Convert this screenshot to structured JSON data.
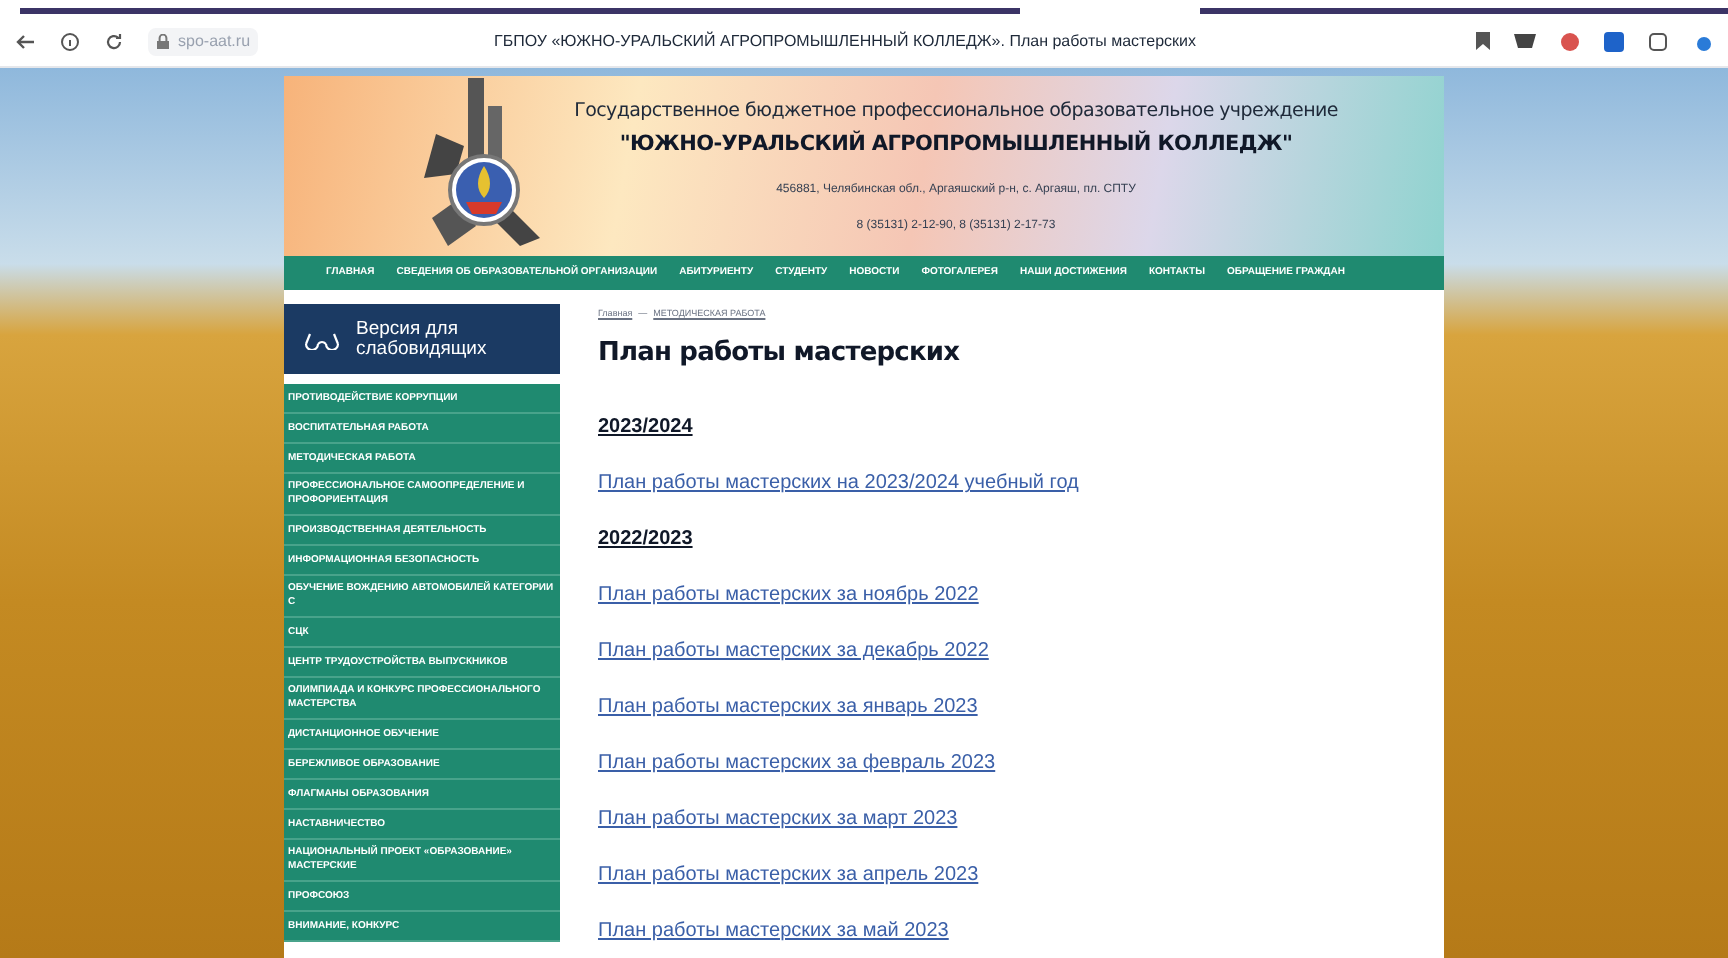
{
  "browser": {
    "url": "spo-aat.ru",
    "tab_title": "ГБПОУ «ЮЖНО-УРАЛЬСКИЙ АГРОПРОМЫШЛЕННЫЙ КОЛЛЕДЖ». План работы мастерских"
  },
  "header": {
    "org_type": "Государственное бюджетное профессиональное образовательное учреждение",
    "org_name": "\"ЮЖНО-УРАЛЬСКИЙ АГРОПРОМЫШЛЕННЫЙ КОЛЛЕДЖ\"",
    "address": "456881, Челябинская обл., Аргаяшский р-н, с. Аргаяш, пл. СПТУ",
    "phones": "8 (35131) 2-12-90, 8 (35131) 2-17-73"
  },
  "nav": [
    "ГЛАВНАЯ",
    "СВЕДЕНИЯ ОБ ОБРАЗОВАТЕЛЬНОЙ ОРГАНИЗАЦИИ",
    "АБИТУРИЕНТУ",
    "СТУДЕНТУ",
    "НОВОСТИ",
    "ФОТОГАЛЕРЕЯ",
    "НАШИ ДОСТИЖЕНИЯ",
    "КОНТАКТЫ",
    "ОБРАЩЕНИЕ ГРАЖДАН"
  ],
  "accessibility_button": "Версия для слабовидящих",
  "sidebar": {
    "items": [
      "ПРОТИВОДЕЙСТВИЕ КОРРУПЦИИ",
      "ВОСПИТАТЕЛЬНАЯ РАБОТА",
      "МЕТОДИЧЕСКАЯ РАБОТА",
      "ПРОФЕССИОНАЛЬНОЕ САМООПРЕДЕЛЕНИЕ И ПРОФОРИЕНТАЦИЯ",
      "ПРОИЗВОДСТВЕННАЯ ДЕЯТЕЛЬНОСТЬ",
      "ИНФОРМАЦИОННАЯ БЕЗОПАСНОСТЬ",
      "ОБУЧЕНИЕ ВОЖДЕНИЮ АВТОМОБИЛЕЙ КАТЕГОРИИ С",
      "СЦК",
      "ЦЕНТР ТРУДОУСТРОЙСТВА ВЫПУСКНИКОВ",
      "ОЛИМПИАДА И КОНКУРС ПРОФЕССИОНАЛЬНОГО МАСТЕРСТВА",
      "ДИСТАНЦИОННОЕ ОБУЧЕНИЕ",
      "БЕРЕЖЛИВОЕ ОБРАЗОВАНИЕ",
      "ФЛАГМАНЫ ОБРАЗОВАНИЯ",
      "НАСТАВНИЧЕСТВО",
      "НАЦИОНАЛЬНЫЙ ПРОЕКТ «ОБРАЗОВАНИЕ» МАСТЕРСКИЕ",
      "ПРОФСОЮЗ",
      "ВНИМАНИЕ, КОНКУРС"
    ]
  },
  "breadcrumbs": [
    "Главная",
    "—",
    "МЕТОДИЧЕСКАЯ РАБОТА"
  ],
  "page_title": "План работы мастерских",
  "content": [
    {
      "kind": "heading",
      "text": "2023/2024"
    },
    {
      "kind": "link",
      "text": "План работы мастерских на 2023/2024 учебный год"
    },
    {
      "kind": "heading",
      "text": "2022/2023"
    },
    {
      "kind": "link",
      "text": "План работы мастерских за ноябрь 2022"
    },
    {
      "kind": "link",
      "text": "План работы мастерских за декабрь 2022"
    },
    {
      "kind": "link",
      "text": "План работы мастерских за январь 2023"
    },
    {
      "kind": "link",
      "text": "План работы мастерских за февраль 2023"
    },
    {
      "kind": "link",
      "text": "План работы мастерских за март 2023"
    },
    {
      "kind": "link",
      "text": "План работы мастерских за апрель 2023"
    },
    {
      "kind": "link",
      "text": "План работы мастерских за май 2023"
    }
  ]
}
